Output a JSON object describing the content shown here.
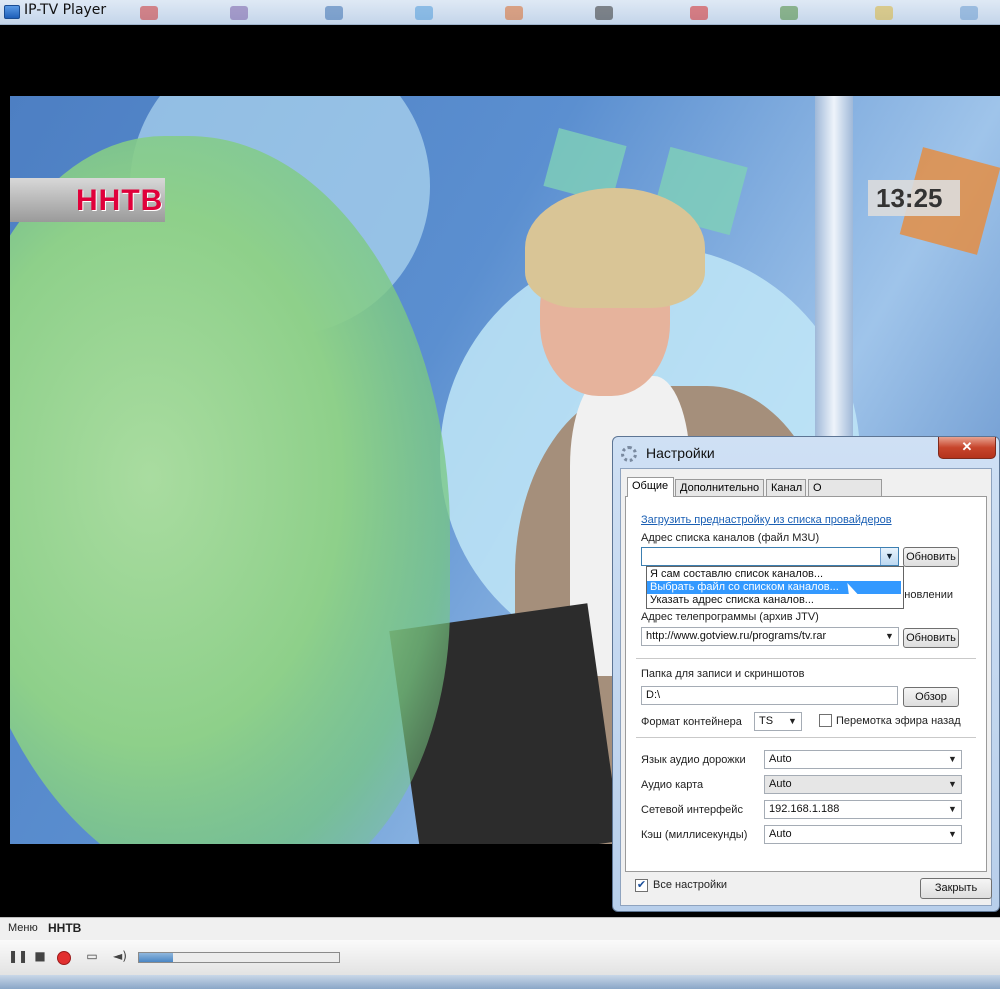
{
  "window": {
    "title": "IP-TV Player"
  },
  "video": {
    "channel_logo": "ННТВ",
    "clock": "13:25"
  },
  "dialog": {
    "title": "Настройки",
    "close_glyph": "✕",
    "tabs": [
      "Общие",
      "Дополнительно",
      "Канал",
      "О программе"
    ],
    "active_tab": "Общие",
    "preset_link": "Загрузить преднастройку из списка провайдеров",
    "playlist": {
      "label": "Адрес списка каналов (файл M3U)",
      "value": "",
      "refresh_button": "Обновить",
      "dropdown_options": [
        "Я сам составлю список каналов...",
        "Выбрать файл со списком каналов...",
        "Указать адрес списка каналов..."
      ],
      "selected_option_index": 1
    },
    "hidden_text_fragment": "бновлении",
    "epg": {
      "label": "Адрес телепрограммы (архив JTV)",
      "value": "http://www.gotview.ru/programs/tv.rar",
      "refresh_button": "Обновить"
    },
    "record_folder": {
      "label": "Папка для записи и скриншотов",
      "value": "D:\\",
      "browse_button": "Обзор"
    },
    "container": {
      "label": "Формат контейнера",
      "value": "TS"
    },
    "timeshift": {
      "label": "Перемотка эфира назад",
      "checked": false
    },
    "audio_track": {
      "label": "Язык аудио дорожки",
      "value": "Auto"
    },
    "audio_card": {
      "label": "Аудио карта",
      "value": "Auto"
    },
    "network_interface": {
      "label": "Сетевой интерфейс",
      "value": "192.168.1.188"
    },
    "cache": {
      "label": "Кэш (миллисекунды)",
      "value": "Auto"
    },
    "all_settings": {
      "label": "Все настройки",
      "checked": true
    },
    "close_button": "Закрыть"
  },
  "bottom": {
    "menu_label": "Меню",
    "channel_name": "ННТВ",
    "volume_level": 0.17
  },
  "colors": {
    "selection": "#3399ff",
    "link": "#1a5fb4",
    "record": "#e23030"
  }
}
